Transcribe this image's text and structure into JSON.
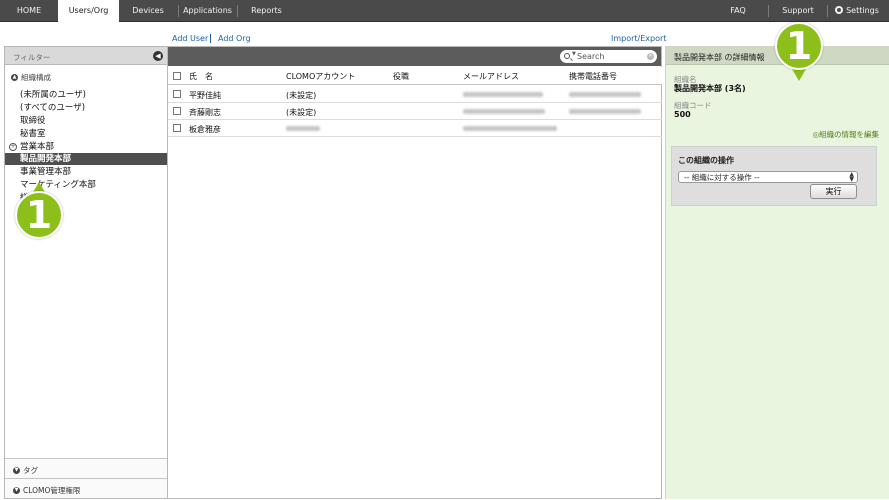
{
  "nav": {
    "tabs": [
      "HOME",
      "Users/Org",
      "Devices",
      "Applications",
      "Reports"
    ],
    "right": [
      "FAQ",
      "Support",
      "Settings"
    ]
  },
  "actions": {
    "add_user": "Add User",
    "add_org": "Add Org",
    "import_export": "Import/Export"
  },
  "filter": {
    "title": "フィルター",
    "collapse_glyph": "◀",
    "org_section": "組織構成",
    "orgs": [
      "(未所属のユーザ)",
      "(すべてのユーザ)",
      "取締役",
      "秘書室",
      "営業本部",
      "製品開発本部",
      "事業管理本部",
      "マーケティング本部",
      "総務部"
    ],
    "selected_index": 5,
    "tag_section": "タグ",
    "clomo_section": "CLOMO管理権限"
  },
  "search": {
    "placeholder": "Search"
  },
  "table": {
    "columns": [
      "氏　名",
      "CLOMOアカウント",
      "役職",
      "メールアドレス",
      "携帯電話番号"
    ],
    "rows": [
      {
        "name": "平野佳純",
        "account": "(未設定)"
      },
      {
        "name": "斉藤剛志",
        "account": "(未設定)"
      },
      {
        "name": "板倉雅彦",
        "account": ""
      }
    ]
  },
  "detail": {
    "title": "製品開発本部 の詳細情報",
    "org_name_label": "組織名",
    "org_name_value": "製品開発本部 (3名)",
    "org_code_label": "組織コード",
    "org_code_value": "500",
    "edit_link": "組織の情報を編集",
    "ops_title": "この組織の操作",
    "ops_select": "-- 組織に対する操作 --",
    "ops_exec": "実行"
  },
  "callouts": [
    "1",
    "1"
  ],
  "colors": {
    "nav_bg": "#4a4a4a",
    "selected_row": "#4f4f4f",
    "detail_bg": "#eaf5e0",
    "callout": "#8cbf1a",
    "link": "#1f5fa8"
  }
}
